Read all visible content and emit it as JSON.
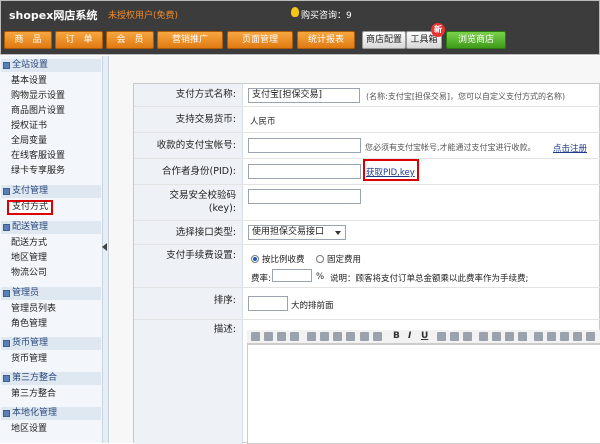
{
  "app": {
    "title": "shopex网店系统",
    "license": "未授权用户(免费)",
    "cart_label": "购买咨询：9"
  },
  "nav": {
    "items": [
      "商　品",
      "订　单",
      "会　员",
      "营销推广",
      "页面管理",
      "统计报表"
    ],
    "gray_items": [
      "商店配置",
      "工具箱"
    ],
    "new_badge": "新",
    "browse": "浏览商店"
  },
  "sidebar": {
    "sections": [
      {
        "title": "全站设置",
        "items": [
          "基本设置",
          "购物显示设置",
          "商品图片设置",
          "授权证书",
          "全局变量",
          "在线客服设置",
          "绿卡专享服务"
        ]
      },
      {
        "title": "支付管理",
        "items": [
          "支付方式"
        ]
      },
      {
        "title": "配送管理",
        "items": [
          "配送方式",
          "地区管理",
          "物流公司"
        ]
      },
      {
        "title": "管理员",
        "items": [
          "管理员列表",
          "角色管理"
        ]
      },
      {
        "title": "货币管理",
        "items": [
          "货币管理"
        ]
      },
      {
        "title": "第三方整合",
        "items": [
          "第三方整合"
        ]
      },
      {
        "title": "本地化管理",
        "items": [
          "地区设置"
        ]
      }
    ]
  },
  "form": {
    "name_label": "支付方式名称:",
    "name_value": "支付宝[担保交易]",
    "name_hint": "(名称:支付宝[担保交易]，您可以自定义支付方式的名称)",
    "currency_label": "支持交易货币:",
    "currency_value": "人民币",
    "account_label": "收款的支付宝帐号:",
    "account_hint": "您必须有支付宝帐号,才能通过支付宝进行收款。",
    "register_link": "点击注册",
    "pid_label": "合作者身份(PID):",
    "pid_link": "获取PID,key",
    "key_label_1": "交易安全校验码",
    "key_label_2": "(key):",
    "interface_label": "选择接口类型:",
    "interface_value": "使用担保交易接口",
    "fee_label": "支付手续费设置:",
    "fee_opt1": "按比例收费",
    "fee_opt2": "固定费用",
    "rate_label": "费率:",
    "rate_unit": "%",
    "rate_desc": "说明：顾客将支付订单总金额乘以此费率作为手续费;",
    "order_label": "排序:",
    "order_hint": "大的排前面",
    "desc_label": "描述:",
    "toolbar_bold": "B",
    "toolbar_italic": "I",
    "toolbar_underline": "U"
  }
}
